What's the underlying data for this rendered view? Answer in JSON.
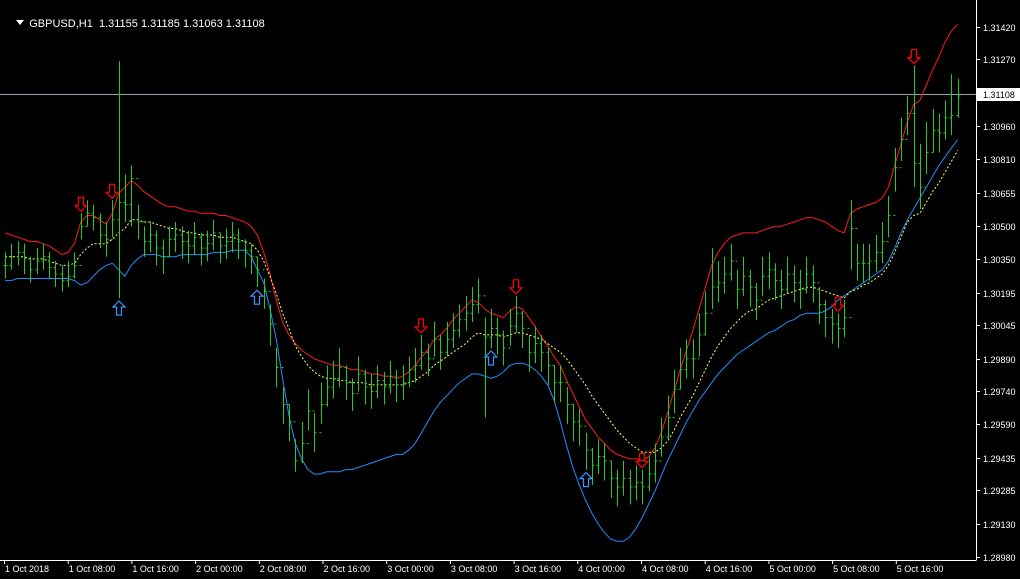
{
  "header": {
    "symbol": "GBPUSD,H1",
    "ohlc": "1.31155 1.31185 1.31063 1.31108"
  },
  "colors": {
    "background": "#000000",
    "foreground": "#ffffff",
    "bars": "#22cc22",
    "upper_band": "#ff1a1a",
    "middle_line": "#ffff66",
    "lower_band": "#1e90ff",
    "sell_arrow": "#ff0000",
    "buy_arrow": "#3399ff",
    "price_line": "#8fa3b0"
  },
  "icons": {
    "sell_signal": "down-arrow-icon",
    "buy_signal": "up-arrow-icon",
    "menu": "triangle-down-icon"
  },
  "current_price": "1.31108",
  "chart_data": {
    "type": "ohlc",
    "title": "GBPUSD,H1",
    "x_tick_labels": [
      "1 Oct 2018",
      "1 Oct 08:00",
      "1 Oct 16:00",
      "2 Oct 00:00",
      "2 Oct 08:00",
      "2 Oct 16:00",
      "3 Oct 00:00",
      "3 Oct 08:00",
      "3 Oct 16:00",
      "4 Oct 00:00",
      "4 Oct 08:00",
      "4 Oct 16:00",
      "5 Oct 00:00",
      "5 Oct 08:00",
      "5 Oct 16:00"
    ],
    "y_tick_labels": [
      "1.31420",
      "1.31270",
      "1.31108",
      "1.30960",
      "1.30810",
      "1.30655",
      "1.30500",
      "1.30350",
      "1.30195",
      "1.30045",
      "1.29890",
      "1.29740",
      "1.29590",
      "1.29435",
      "1.29285",
      "1.29130",
      "1.28980"
    ],
    "ylim": [
      1.2898,
      1.3142
    ],
    "grid": false,
    "series_names": [],
    "close": [
      1.3032,
      1.3036,
      1.3038,
      1.3035,
      1.303,
      1.3034,
      1.3036,
      1.3031,
      1.3028,
      1.3025,
      1.3027,
      1.3032,
      1.305,
      1.3056,
      1.3054,
      1.3046,
      1.3044,
      1.3053,
      1.3061,
      1.306,
      1.3072,
      1.3052,
      1.3043,
      1.3046,
      1.304,
      1.3036,
      1.3044,
      1.3046,
      1.3043,
      1.3041,
      1.3045,
      1.304,
      1.3042,
      1.3047,
      1.3041,
      1.3043,
      1.3046,
      1.3043,
      1.3039,
      1.3036,
      1.303,
      1.302,
      1.3005,
      1.2985,
      1.2968,
      1.296,
      1.2942,
      1.295,
      1.2965,
      1.2955,
      1.2968,
      1.2976,
      1.298,
      1.2985,
      1.2978,
      1.2973,
      1.2982,
      1.2976,
      1.2974,
      1.2979,
      1.2976,
      1.2981,
      1.2977,
      1.2978,
      1.2984,
      1.2986,
      1.2992,
      1.2989,
      1.2998,
      1.2992,
      1.2998,
      1.3002,
      1.3007,
      1.301,
      1.3014,
      1.3018,
      1.2999,
      1.3003,
      1.3,
      1.2994,
      1.3004,
      1.301,
      1.3003,
      1.2992,
      1.2996,
      1.2992,
      1.2986,
      1.2978,
      1.2978,
      1.2968,
      1.296,
      1.2958,
      1.2947,
      1.294,
      1.2944,
      1.2942,
      1.2934,
      1.293,
      1.2934,
      1.293,
      1.2932,
      1.293,
      1.2936,
      1.2942,
      1.2953,
      1.2962,
      1.2975,
      1.2984,
      1.2989,
      1.2989,
      1.3,
      1.301,
      1.3022,
      1.3024,
      1.3028,
      1.3034,
      1.3021,
      1.3027,
      1.3022,
      1.3016,
      1.3027,
      1.303,
      1.3025,
      1.3021,
      1.3028,
      1.3024,
      1.3021,
      1.3028,
      1.3024,
      1.3014,
      1.3008,
      1.3005,
      1.3003,
      1.3008,
      1.3049,
      1.3033,
      1.3033,
      1.3034,
      1.3038,
      1.3043,
      1.3055,
      1.3077,
      1.309,
      1.3102,
      1.3079,
      1.3068,
      1.3084,
      1.3094,
      1.3093,
      1.31,
      1.3101,
      1.311
    ],
    "high": [
      1.3038,
      1.3042,
      1.3043,
      1.3042,
      1.3036,
      1.304,
      1.3042,
      1.3038,
      1.3034,
      1.3032,
      1.3034,
      1.3038,
      1.3056,
      1.3062,
      1.306,
      1.3056,
      1.3052,
      1.3062,
      1.3126,
      1.3074,
      1.3078,
      1.306,
      1.305,
      1.3052,
      1.3048,
      1.3044,
      1.305,
      1.3052,
      1.305,
      1.3048,
      1.3052,
      1.3047,
      1.3048,
      1.3053,
      1.3047,
      1.3049,
      1.3052,
      1.3049,
      1.3044,
      1.3042,
      1.3036,
      1.3026,
      1.3014,
      1.2994,
      1.2976,
      1.2968,
      1.2952,
      1.296,
      1.2975,
      1.2964,
      1.2978,
      1.2986,
      1.2988,
      1.2994,
      1.2986,
      1.298,
      1.299,
      1.2984,
      1.2982,
      1.2986,
      1.2983,
      1.2988,
      1.2984,
      1.2986,
      1.299,
      1.2994,
      1.3,
      1.2996,
      1.3006,
      1.3,
      1.3006,
      1.301,
      1.3014,
      1.3018,
      1.3022,
      1.3026,
      1.3008,
      1.3012,
      1.3008,
      1.3002,
      1.3012,
      1.3018,
      1.3011,
      1.3,
      1.3004,
      1.3,
      1.2994,
      1.2986,
      1.2986,
      1.2976,
      1.2968,
      1.2966,
      1.2955,
      1.2948,
      1.2952,
      1.295,
      1.2942,
      1.2938,
      1.2942,
      1.2938,
      1.294,
      1.2938,
      1.2944,
      1.295,
      1.2962,
      1.2972,
      1.2984,
      1.2994,
      1.2998,
      1.2998,
      1.301,
      1.302,
      1.304,
      1.3034,
      1.3036,
      1.3042,
      1.303,
      1.3036,
      1.303,
      1.3024,
      1.3036,
      1.3038,
      1.3033,
      1.303,
      1.3036,
      1.3032,
      1.303,
      1.3036,
      1.3032,
      1.3022,
      1.3016,
      1.3012,
      1.301,
      1.3016,
      1.3062,
      1.3042,
      1.3042,
      1.3042,
      1.3046,
      1.3052,
      1.3064,
      1.3086,
      1.31,
      1.311,
      1.3124,
      1.3088,
      1.3098,
      1.3104,
      1.3102,
      1.3108,
      1.312,
      1.3118
    ],
    "low": [
      1.3026,
      1.303,
      1.3032,
      1.3028,
      1.3024,
      1.3028,
      1.303,
      1.3026,
      1.3022,
      1.302,
      1.3022,
      1.3026,
      1.3044,
      1.305,
      1.3048,
      1.304,
      1.3036,
      1.3045,
      1.3017,
      1.3052,
      1.305,
      1.3044,
      1.3036,
      1.3038,
      1.3032,
      1.3028,
      1.3036,
      1.3038,
      1.3035,
      1.3033,
      1.3037,
      1.3032,
      1.3034,
      1.3039,
      1.3033,
      1.3035,
      1.3038,
      1.3035,
      1.3031,
      1.3028,
      1.3022,
      1.3012,
      1.2995,
      1.2976,
      1.2959,
      1.2951,
      1.2937,
      1.2941,
      1.2956,
      1.2946,
      1.2959,
      1.2967,
      1.2971,
      1.2976,
      1.297,
      1.2965,
      1.2974,
      1.2968,
      1.2966,
      1.2971,
      1.2968,
      1.2973,
      1.2969,
      1.297,
      1.2976,
      1.2978,
      1.2984,
      1.2981,
      1.299,
      1.2984,
      1.299,
      1.2994,
      1.2999,
      1.3002,
      1.3006,
      1.301,
      1.2962,
      1.2994,
      1.2991,
      1.2986,
      1.2995,
      1.3001,
      1.2994,
      1.2983,
      1.2987,
      1.2983,
      1.2977,
      1.2969,
      1.2969,
      1.2959,
      1.2951,
      1.2949,
      1.2938,
      1.2931,
      1.2936,
      1.2933,
      1.2925,
      1.2921,
      1.2926,
      1.2922,
      1.2924,
      1.2922,
      1.2928,
      1.2932,
      1.2944,
      1.2952,
      1.2964,
      1.2975,
      1.298,
      1.298,
      1.299,
      1.3,
      1.3012,
      1.3015,
      1.3019,
      1.3025,
      1.3012,
      1.3018,
      1.3013,
      1.3007,
      1.3018,
      1.3021,
      1.3016,
      1.3012,
      1.3019,
      1.3015,
      1.3012,
      1.3019,
      1.3015,
      1.3005,
      1.2999,
      1.2996,
      1.2994,
      1.2999,
      1.303,
      1.3025,
      1.3024,
      1.3025,
      1.3029,
      1.3033,
      1.3045,
      1.3066,
      1.308,
      1.3092,
      1.3068,
      1.3058,
      1.3074,
      1.3084,
      1.3084,
      1.309,
      1.3092,
      1.31
    ],
    "upper_band": [
      1.3047,
      1.3046,
      1.3045,
      1.3044,
      1.3043,
      1.3043,
      1.3042,
      1.3041,
      1.3039,
      1.3037,
      1.3038,
      1.3042,
      1.3052,
      1.3055,
      1.3055,
      1.3053,
      1.3051,
      1.3056,
      1.3065,
      1.3068,
      1.3071,
      1.3069,
      1.3066,
      1.3064,
      1.3062,
      1.306,
      1.3059,
      1.3059,
      1.3058,
      1.3057,
      1.3057,
      1.3056,
      1.3056,
      1.3056,
      1.3055,
      1.3055,
      1.3054,
      1.3053,
      1.3052,
      1.305,
      1.3046,
      1.3038,
      1.3028,
      1.3016,
      1.3006,
      1.3,
      1.2996,
      1.2993,
      1.2991,
      1.2989,
      1.2988,
      1.2987,
      1.2986,
      1.2986,
      1.2985,
      1.2984,
      1.2984,
      1.2983,
      1.2982,
      1.2982,
      1.2981,
      1.2981,
      1.298,
      1.2981,
      1.2983,
      1.2986,
      1.299,
      1.2993,
      1.2998,
      1.3,
      1.3003,
      1.3007,
      1.301,
      1.3013,
      1.3016,
      1.3015,
      1.3012,
      1.301,
      1.3009,
      1.3008,
      1.3011,
      1.3013,
      1.3012,
      1.3008,
      1.3004,
      1.2999,
      1.2995,
      1.299,
      1.2986,
      1.2979,
      1.2973,
      1.2967,
      1.2961,
      1.2957,
      1.2953,
      1.295,
      1.2947,
      1.2945,
      1.2944,
      1.2943,
      1.2943,
      1.2942,
      1.2944,
      1.2948,
      1.2955,
      1.2964,
      1.2974,
      1.2984,
      1.2993,
      1.3002,
      1.3012,
      1.3022,
      1.3032,
      1.3038,
      1.3042,
      1.3045,
      1.3046,
      1.3047,
      1.3047,
      1.3047,
      1.3048,
      1.3049,
      1.305,
      1.305,
      1.3051,
      1.3052,
      1.3053,
      1.3054,
      1.3054,
      1.3053,
      1.3052,
      1.305,
      1.3048,
      1.3047,
      1.3056,
      1.3058,
      1.3059,
      1.306,
      1.3061,
      1.3063,
      1.3068,
      1.3078,
      1.3088,
      1.3098,
      1.3106,
      1.3108,
      1.3115,
      1.3122,
      1.3128,
      1.3135,
      1.314,
      1.3143
    ],
    "middle_line": [
      1.3036,
      1.3036,
      1.3036,
      1.3036,
      1.3035,
      1.3035,
      1.3035,
      1.3034,
      1.3033,
      1.3032,
      1.3032,
      1.3033,
      1.3037,
      1.304,
      1.3042,
      1.3042,
      1.3042,
      1.3044,
      1.3047,
      1.3049,
      1.3053,
      1.3053,
      1.3052,
      1.3052,
      1.3051,
      1.305,
      1.3049,
      1.3049,
      1.3048,
      1.3047,
      1.3047,
      1.3046,
      1.3046,
      1.3046,
      1.3045,
      1.3045,
      1.3045,
      1.3044,
      1.3043,
      1.3042,
      1.3039,
      1.3034,
      1.3027,
      1.3019,
      1.301,
      1.3003,
      1.2995,
      1.299,
      1.2986,
      1.2983,
      1.2981,
      1.298,
      1.298,
      1.2979,
      1.2979,
      1.2978,
      1.2978,
      1.2978,
      1.2977,
      1.2977,
      1.2977,
      1.2977,
      1.2977,
      1.2977,
      1.2978,
      1.2979,
      1.2981,
      1.2983,
      1.2986,
      1.2988,
      1.299,
      1.2992,
      1.2994,
      1.2996,
      1.2999,
      1.3001,
      1.3,
      1.3,
      1.3,
      1.2999,
      1.3,
      1.3001,
      1.3001,
      1.3,
      1.2999,
      1.2998,
      1.2996,
      1.2994,
      1.2992,
      1.2989,
      1.2985,
      1.2981,
      1.2977,
      1.2972,
      1.2968,
      1.2964,
      1.296,
      1.2956,
      1.2953,
      1.295,
      1.2948,
      1.2946,
      1.2946,
      1.2946,
      1.2948,
      1.2951,
      1.2956,
      1.2962,
      1.2967,
      1.2972,
      1.2978,
      1.2984,
      1.299,
      1.2995,
      1.2999,
      1.3003,
      1.3006,
      1.3009,
      1.3011,
      1.3012,
      1.3014,
      1.3016,
      1.3017,
      1.3018,
      1.3019,
      1.302,
      1.3021,
      1.3022,
      1.3022,
      1.3021,
      1.302,
      1.3019,
      1.3018,
      1.3017,
      1.302,
      1.3021,
      1.3023,
      1.3024,
      1.3026,
      1.3028,
      1.3032,
      1.3038,
      1.3045,
      1.3052,
      1.3055,
      1.3056,
      1.3061,
      1.3066,
      1.307,
      1.3075,
      1.308,
      1.3085
    ],
    "lower_band": [
      1.3025,
      1.3025,
      1.3026,
      1.3026,
      1.3026,
      1.3026,
      1.3026,
      1.3026,
      1.3026,
      1.3026,
      1.3026,
      1.3025,
      1.3023,
      1.3024,
      1.3027,
      1.303,
      1.3032,
      1.3033,
      1.303,
      1.3027,
      1.3032,
      1.3035,
      1.3037,
      1.3037,
      1.3037,
      1.3036,
      1.3036,
      1.3036,
      1.3037,
      1.3037,
      1.3037,
      1.3037,
      1.3037,
      1.3038,
      1.3038,
      1.3038,
      1.3039,
      1.3039,
      1.3039,
      1.3036,
      1.303,
      1.3024,
      1.3012,
      1.2998,
      1.298,
      1.2963,
      1.295,
      1.2943,
      1.2938,
      1.2936,
      1.2936,
      1.2937,
      1.2937,
      1.2937,
      1.2938,
      1.2938,
      1.2939,
      1.294,
      1.2941,
      1.2942,
      1.2943,
      1.2944,
      1.2945,
      1.2945,
      1.2947,
      1.295,
      1.2955,
      1.296,
      1.2965,
      1.2969,
      1.2972,
      1.2975,
      1.2978,
      1.298,
      1.2982,
      1.2982,
      1.2981,
      1.298,
      1.2981,
      1.2983,
      1.2986,
      1.2987,
      1.2987,
      1.2986,
      1.2984,
      1.2981,
      1.2977,
      1.297,
      1.296,
      1.2949,
      1.2939,
      1.2931,
      1.2924,
      1.2918,
      1.2913,
      1.2909,
      1.2906,
      1.2905,
      1.2905,
      1.2907,
      1.2911,
      1.2916,
      1.2922,
      1.2928,
      1.2935,
      1.2942,
      1.2948,
      1.2954,
      1.296,
      1.2965,
      1.297,
      1.2974,
      1.2978,
      1.2982,
      1.2985,
      1.2988,
      1.2991,
      1.2993,
      1.2995,
      1.2997,
      1.2999,
      1.3001,
      1.3002,
      1.3004,
      1.3006,
      1.3007,
      1.3009,
      1.301,
      1.301,
      1.301,
      1.3011,
      1.3013,
      1.3016,
      1.3018,
      1.302,
      1.3022,
      1.3024,
      1.3026,
      1.3028,
      1.303,
      1.3034,
      1.304,
      1.3047,
      1.3053,
      1.3058,
      1.3063,
      1.3068,
      1.3073,
      1.3078,
      1.3082,
      1.3086,
      1.309
    ],
    "sell_signals_bar_index": [
      12,
      17,
      66,
      81,
      101,
      132,
      144
    ],
    "buy_signals_bar_index": [
      18,
      40,
      77,
      92
    ],
    "current_price_line": 1.31108
  }
}
